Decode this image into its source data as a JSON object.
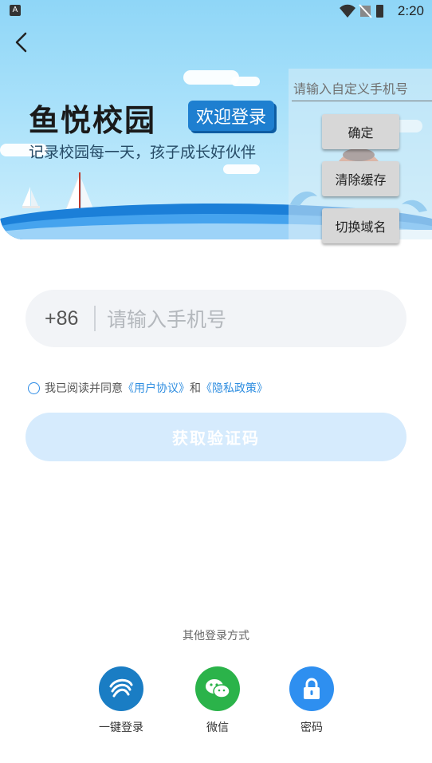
{
  "status_bar": {
    "time": "2:20",
    "notification_icon": "A"
  },
  "header": {
    "brand_title": "鱼悦校园",
    "welcome_badge": "欢迎登录",
    "slogan": "记录校园每一天，孩子成长好伙伴"
  },
  "dev_panel": {
    "custom_phone_placeholder": "请输入自定义手机号",
    "confirm_label": "确定",
    "clear_cache_label": "清除缓存",
    "switch_domain_label": "切换域名"
  },
  "login_form": {
    "country_code": "+86",
    "phone_placeholder": "请输入手机号",
    "agreement_prefix": "我已阅读并同意",
    "user_agreement": "《用户协议》",
    "agreement_and": "和",
    "privacy_policy": "《隐私政策》",
    "get_code_label": "获取验证码"
  },
  "other_login": {
    "title": "其他登录方式",
    "options": [
      {
        "label": "一键登录",
        "icon": "china-mobile-icon",
        "color": "#1a7dc4"
      },
      {
        "label": "微信",
        "icon": "wechat-icon",
        "color": "#2bb34a"
      },
      {
        "label": "密码",
        "icon": "lock-icon",
        "color": "#2e8ff0"
      }
    ]
  },
  "colors": {
    "accent": "#2f8ee0",
    "button_disabled": "#d6ebfd",
    "badge": "#1e7fd0"
  }
}
